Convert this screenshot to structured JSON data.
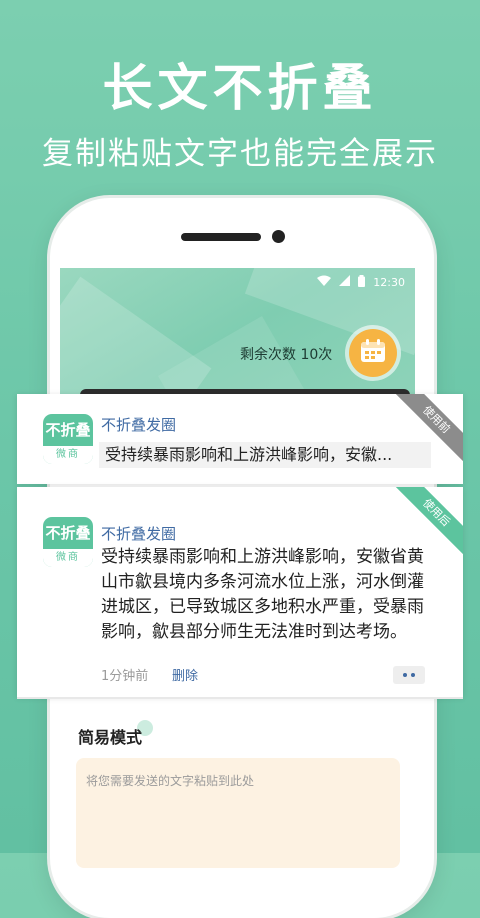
{
  "hero": {
    "title": "长文不折叠",
    "subtitle": "复制粘贴文字也能完全展示"
  },
  "status_bar": {
    "time": "12:30"
  },
  "app": {
    "remaining_label": "剩余次数  10次",
    "accent_color": "#5cc49e",
    "link_color": "#3f6aa3"
  },
  "card_before": {
    "ribbon": "使用前",
    "logo_main": "不折叠",
    "logo_sub": "微商",
    "name": "不折叠发圈",
    "text": "受持续暴雨影响和上游洪峰影响，安徽..."
  },
  "card_after": {
    "ribbon": "使用后",
    "logo_main": "不折叠",
    "logo_sub": "微商",
    "name": "不折叠发圈",
    "text": "受持续暴雨影响和上游洪峰影响，安徽省黄山市歙县境内多条河流水位上涨，河水倒灌进城区，已导致城区多地积水严重，受暴雨影响，歙县部分师生无法准时到达考场。",
    "time": "1分钟前",
    "delete": "删除"
  },
  "simple_mode": {
    "title": "简易模式",
    "placeholder": "将您需要发送的文字粘贴到此处"
  }
}
